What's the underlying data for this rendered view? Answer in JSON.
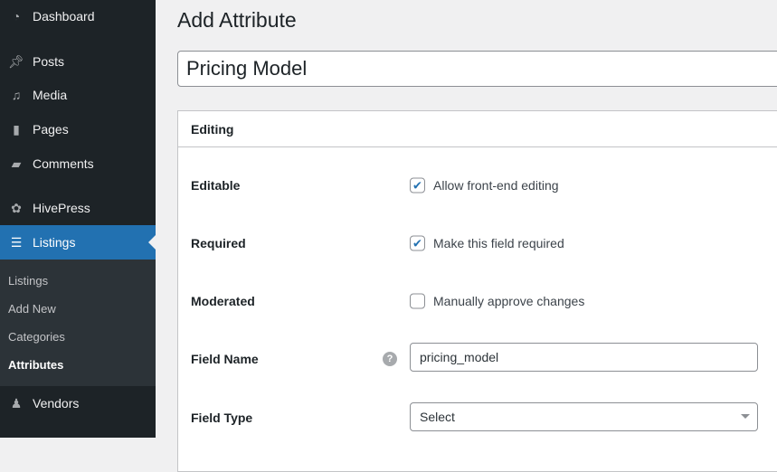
{
  "sidebar": {
    "items": [
      {
        "label": "Dashboard",
        "icon": "dashboard-icon"
      },
      {
        "label": "Posts",
        "icon": "pin-icon"
      },
      {
        "label": "Media",
        "icon": "media-icon"
      },
      {
        "label": "Pages",
        "icon": "pages-icon"
      },
      {
        "label": "Comments",
        "icon": "comment-icon"
      },
      {
        "label": "HivePress",
        "icon": "hivepress-icon"
      },
      {
        "label": "Listings",
        "icon": "listings-icon"
      },
      {
        "label": "Vendors",
        "icon": "user-icon"
      }
    ],
    "submenu": [
      "Listings",
      "Add New",
      "Categories",
      "Attributes"
    ],
    "accent": "#2271b1"
  },
  "page": {
    "title": "Add Attribute",
    "name_value": "Pricing Model"
  },
  "panel": {
    "title": "Editing",
    "rows": [
      {
        "label": "Editable",
        "checkbox_label": "Allow front-end editing",
        "checked": true
      },
      {
        "label": "Required",
        "checkbox_label": "Make this field required",
        "checked": true
      },
      {
        "label": "Moderated",
        "checkbox_label": "Manually approve changes",
        "checked": false
      }
    ],
    "field_name": {
      "label": "Field Name",
      "value": "pricing_model",
      "help": "?"
    },
    "field_type": {
      "label": "Field Type",
      "value": "Select"
    }
  }
}
